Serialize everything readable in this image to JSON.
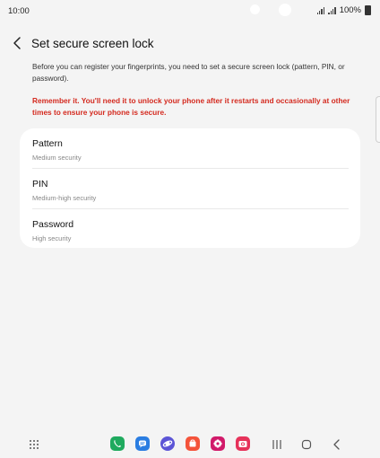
{
  "status": {
    "time": "10:00",
    "battery": "100%"
  },
  "header": {
    "title": "Set secure screen lock"
  },
  "description": "Before you can register your fingerprints, you need to set a secure screen lock (pattern, PIN, or password).",
  "warning": "Remember it. You'll need it to unlock your phone after it restarts and occasionally at other times to ensure your phone is secure.",
  "options": [
    {
      "label": "Pattern",
      "sublabel": "Medium security"
    },
    {
      "label": "PIN",
      "sublabel": "Medium-high security"
    },
    {
      "label": "Password",
      "sublabel": "High security"
    }
  ],
  "dock": {
    "apps": [
      "phone-icon",
      "messages-icon",
      "internet-icon",
      "galaxy-store-icon",
      "gallery-icon",
      "camera-icon"
    ],
    "colors": {
      "phone": "#1faa5e",
      "messages": "#2a7de1",
      "internet": "#5c55d6",
      "store": "#f4533a",
      "gallery": "#d11a6a",
      "camera": "#e6325a"
    }
  },
  "colors": {
    "warning": "#d42a1f",
    "background": "#f4f4f4",
    "card": "#ffffff"
  }
}
